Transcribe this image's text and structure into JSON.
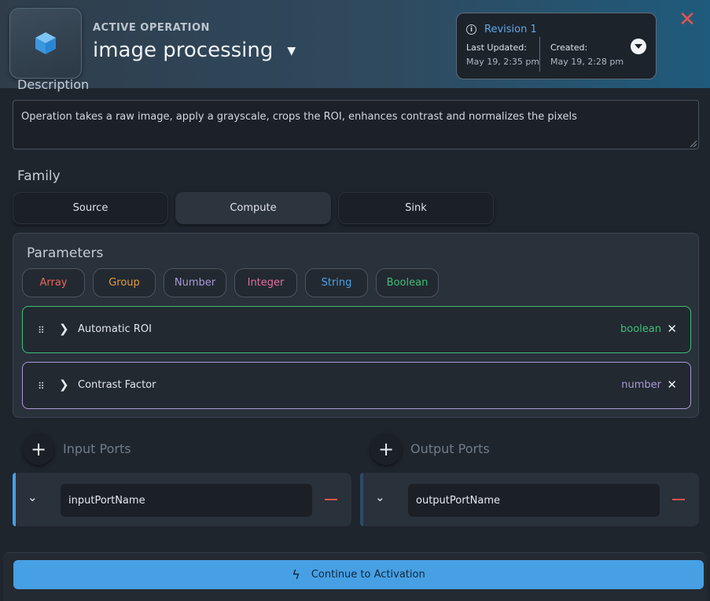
{
  "header": {
    "eyebrow": "ACTIVE OPERATION",
    "title": "image processing",
    "revision": {
      "title": "Revision 1",
      "last_updated_label": "Last Updated:",
      "last_updated_value": "May 19, 2:35 pm",
      "created_label": "Created:",
      "created_value": "May 19, 2:28 pm"
    }
  },
  "description": {
    "label": "Description",
    "value": "Operation takes a raw image, apply a grayscale, crops the ROI, enhances contrast and normalizes the pixels"
  },
  "family": {
    "label": "Family",
    "options": [
      "Source",
      "Compute",
      "Sink"
    ],
    "selected": "Compute"
  },
  "parameters": {
    "title": "Parameters",
    "types": [
      {
        "label": "Array",
        "color": "#e8675e"
      },
      {
        "label": "Group",
        "color": "#e49a46"
      },
      {
        "label": "Number",
        "color": "#a99ad8"
      },
      {
        "label": "Integer",
        "color": "#df6fa0"
      },
      {
        "label": "String",
        "color": "#4ea3ea"
      },
      {
        "label": "Boolean",
        "color": "#3fbf78"
      }
    ],
    "items": [
      {
        "name": "Automatic ROI",
        "type": "boolean",
        "color": "#3fbf78"
      },
      {
        "name": "Contrast Factor",
        "type": "number",
        "color": "#a99ad8"
      }
    ]
  },
  "ports": {
    "input": {
      "title": "Input Ports",
      "name": "inputPortName",
      "accent": "#47a0e4"
    },
    "output": {
      "title": "Output Ports",
      "name": "outputPortName",
      "accent": "#2e4a66"
    }
  },
  "footer": {
    "continue_label": "Continue to Activation"
  },
  "icons": [
    "cube-icon",
    "dropdown-caret-icon",
    "info-icon",
    "chevron-down-icon",
    "close-icon",
    "drag-handle-icon",
    "chevron-right-icon",
    "plus-icon",
    "minus-icon",
    "lightning-icon"
  ]
}
